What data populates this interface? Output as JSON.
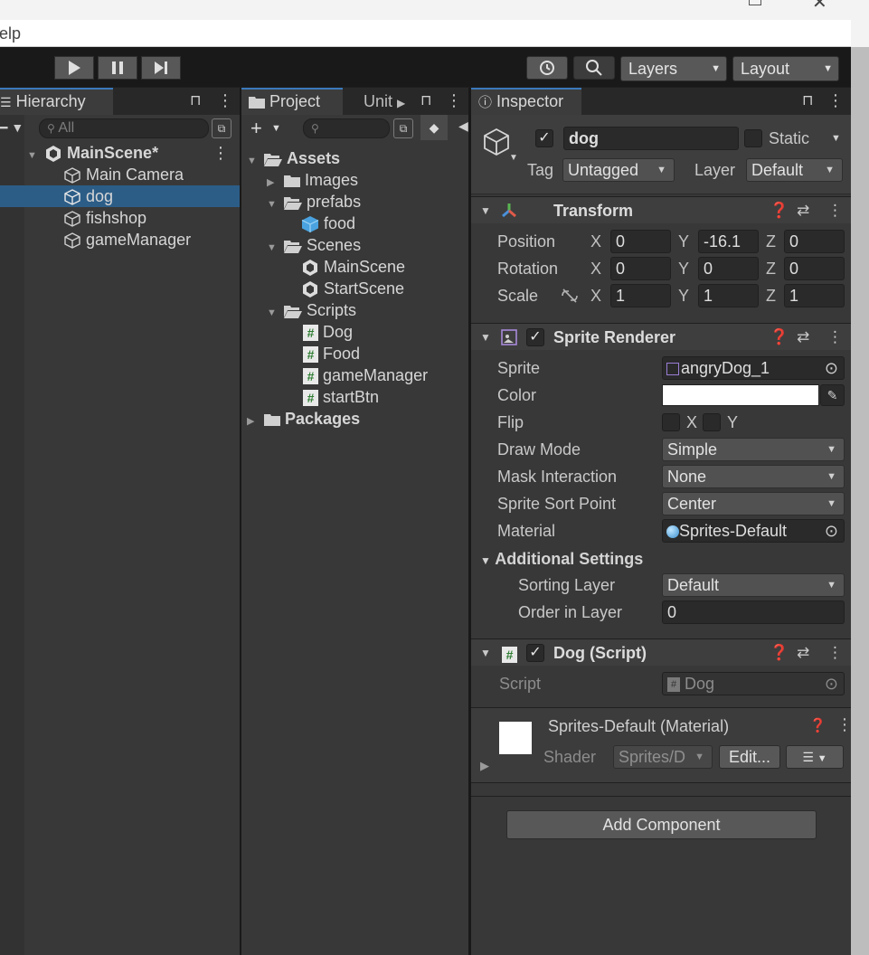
{
  "menu": {
    "partial_item": "elp"
  },
  "toolbar": {
    "layers_label": "Layers",
    "layout_label": "Layout"
  },
  "hierarchy": {
    "tab_label": "Hierarchy",
    "search_placeholder": "All",
    "scene_name": "MainScene*",
    "items": [
      "Main Camera",
      "dog",
      "fishshop",
      "gameManager"
    ],
    "selected_item": "dog"
  },
  "project": {
    "tab_label": "Project",
    "tab2_label": "Unit",
    "tree": {
      "assets": "Assets",
      "images": "Images",
      "prefabs": "prefabs",
      "food": "food",
      "scenes": "Scenes",
      "main_scene": "MainScene",
      "start_scene": "StartScene",
      "scripts": "Scripts",
      "script_items": [
        "Dog",
        "Food",
        "gameManager",
        "startBtn"
      ],
      "packages": "Packages"
    }
  },
  "inspector": {
    "tab_label": "Inspector",
    "object_name": "dog",
    "static_label": "Static",
    "tag_label": "Tag",
    "tag_value": "Untagged",
    "layer_label": "Layer",
    "layer_value": "Default",
    "transform": {
      "title": "Transform",
      "position_label": "Position",
      "rotation_label": "Rotation",
      "scale_label": "Scale",
      "axis": [
        "X",
        "Y",
        "Z"
      ],
      "position": [
        "0",
        "-16.1",
        "0"
      ],
      "rotation": [
        "0",
        "0",
        "0"
      ],
      "scale": [
        "1",
        "1",
        "1"
      ]
    },
    "sprite_renderer": {
      "title": "Sprite Renderer",
      "sprite_label": "Sprite",
      "sprite_value": "angryDog_1",
      "color_label": "Color",
      "color_value": "#ffffff",
      "flip_label": "Flip",
      "flip_x": "X",
      "flip_y": "Y",
      "draw_mode_label": "Draw Mode",
      "draw_mode_value": "Simple",
      "mask_label": "Mask Interaction",
      "mask_value": "None",
      "sort_point_label": "Sprite Sort Point",
      "sort_point_value": "Center",
      "material_label": "Material",
      "material_value": "Sprites-Default",
      "additional_label": "Additional Settings",
      "sorting_layer_label": "Sorting Layer",
      "sorting_layer_value": "Default",
      "order_label": "Order in Layer",
      "order_value": "0"
    },
    "dog_script": {
      "title": "Dog (Script)",
      "script_label": "Script",
      "script_value": "Dog"
    },
    "material": {
      "title": "Sprites-Default (Material)",
      "shader_label": "Shader",
      "shader_value": "Sprites/D",
      "edit_label": "Edit..."
    },
    "add_component_label": "Add Component"
  },
  "colors": {
    "selection": "#2c5d87",
    "accent_tab": "#3a79bb",
    "panel": "#383838"
  }
}
